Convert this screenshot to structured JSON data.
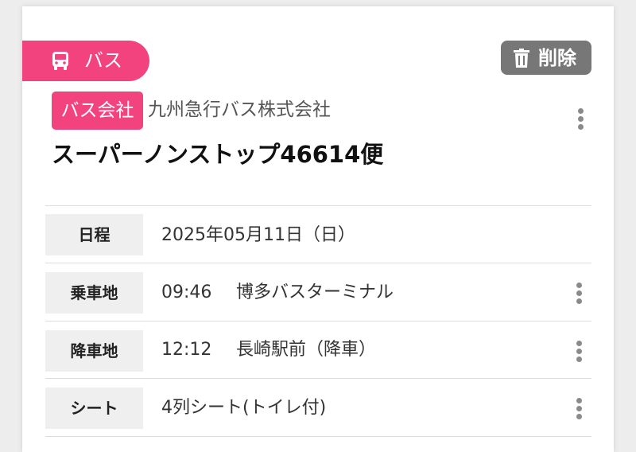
{
  "tag": {
    "label": "バス",
    "icon": "bus-icon",
    "color": "#f2437e"
  },
  "delete_button": {
    "label": "削除",
    "icon": "trash-icon",
    "color": "#777777"
  },
  "company": {
    "badge": "バス会社",
    "name": "九州急行バス株式会社"
  },
  "service": {
    "name": "スーパーノンストップ46614便"
  },
  "details": [
    {
      "label": "日程",
      "value": "2025年05月11日（日）"
    },
    {
      "label": "乗車地",
      "time": "09:46",
      "place": "博多バスターミナル"
    },
    {
      "label": "降車地",
      "time": "12:12",
      "place": "長崎駅前（降車）"
    },
    {
      "label": "シート",
      "value": "4列シート(トイレ付)"
    }
  ]
}
